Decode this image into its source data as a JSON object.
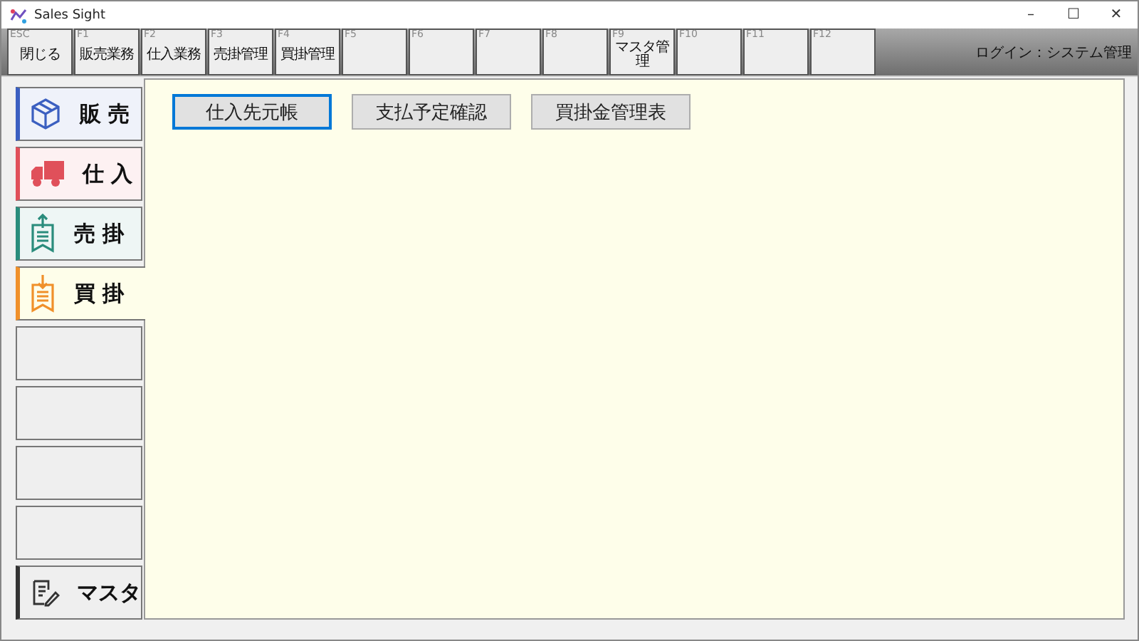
{
  "window": {
    "title": "Sales Sight",
    "controls": [
      "–",
      "☐",
      "✕"
    ]
  },
  "function_keys": [
    {
      "key": "ESC",
      "label": "閉じる"
    },
    {
      "key": "F1",
      "label": "販売業務"
    },
    {
      "key": "F2",
      "label": "仕入業務"
    },
    {
      "key": "F3",
      "label": "売掛管理"
    },
    {
      "key": "F4",
      "label": "買掛管理"
    },
    {
      "key": "F5"
    },
    {
      "key": "F6"
    },
    {
      "key": "F7"
    },
    {
      "key": "F8"
    },
    {
      "key": "F9",
      "label": "マスタ管理"
    },
    {
      "key": "F10"
    },
    {
      "key": "F11"
    },
    {
      "key": "F12"
    }
  ],
  "login": "ログイン：システム管理",
  "sidebar": {
    "items": [
      {
        "kind": "box",
        "label": "販 売",
        "color": "#3b5fc0",
        "selected": false
      },
      {
        "kind": "truck",
        "label": "仕 入",
        "color": "#e0505a",
        "selected": false
      },
      {
        "kind": "upload",
        "label": "売 掛",
        "color": "#2a8c7c",
        "selected": false
      },
      {
        "kind": "download",
        "label": "買 掛",
        "color": "#f0902a",
        "selected": true
      },
      {
        "kind": "empty",
        "selected": false
      },
      {
        "kind": "empty",
        "selected": false
      },
      {
        "kind": "empty",
        "selected": false
      },
      {
        "kind": "empty",
        "selected": false
      },
      {
        "kind": "note",
        "label": "マスタ",
        "color": "#333333",
        "selected": false
      }
    ]
  },
  "buttons": [
    {
      "label": "仕入先元帳",
      "selected": true
    },
    {
      "label": "支払予定確認",
      "selected": false
    },
    {
      "label": "買掛金管理表",
      "selected": false
    }
  ]
}
